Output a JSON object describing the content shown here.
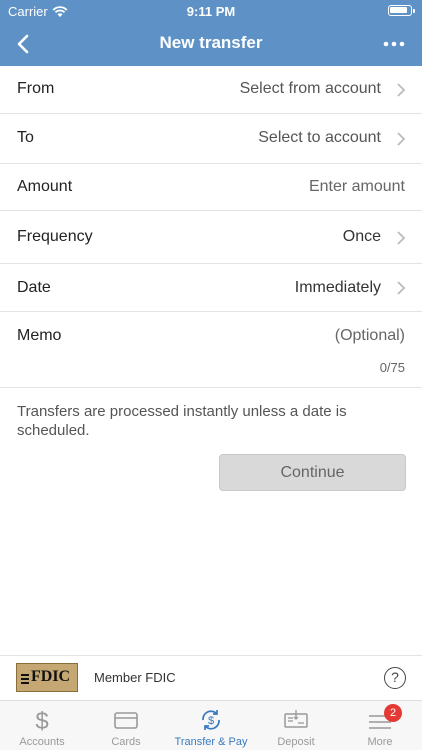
{
  "status_bar": {
    "carrier": "Carrier",
    "time": "9:11 PM"
  },
  "nav": {
    "title": "New transfer"
  },
  "form": {
    "from": {
      "label": "From",
      "value": "Select from account"
    },
    "to": {
      "label": "To",
      "value": "Select to account"
    },
    "amount": {
      "label": "Amount",
      "placeholder": "Enter amount"
    },
    "frequency": {
      "label": "Frequency",
      "value": "Once"
    },
    "date": {
      "label": "Date",
      "value": "Immediately"
    },
    "memo": {
      "label": "Memo",
      "placeholder": "(Optional)",
      "counter": "0/75"
    }
  },
  "info_text": "Transfers are processed instantly unless a date is scheduled.",
  "continue_label": "Continue",
  "footer": {
    "fdic_logo_text": "FDIC",
    "member_text": "Member FDIC",
    "help_symbol": "?"
  },
  "tabs": [
    {
      "label": "Accounts",
      "icon": "dollar-icon"
    },
    {
      "label": "Cards",
      "icon": "card-icon"
    },
    {
      "label": "Transfer & Pay",
      "icon": "transfer-pay-icon",
      "active": true
    },
    {
      "label": "Deposit",
      "icon": "check-deposit-icon"
    },
    {
      "label": "More",
      "icon": "menu-icon",
      "badge": "2"
    }
  ],
  "colors": {
    "header": "#5e92c6",
    "active_tab": "#3a7bbf",
    "badge": "#e53935"
  }
}
